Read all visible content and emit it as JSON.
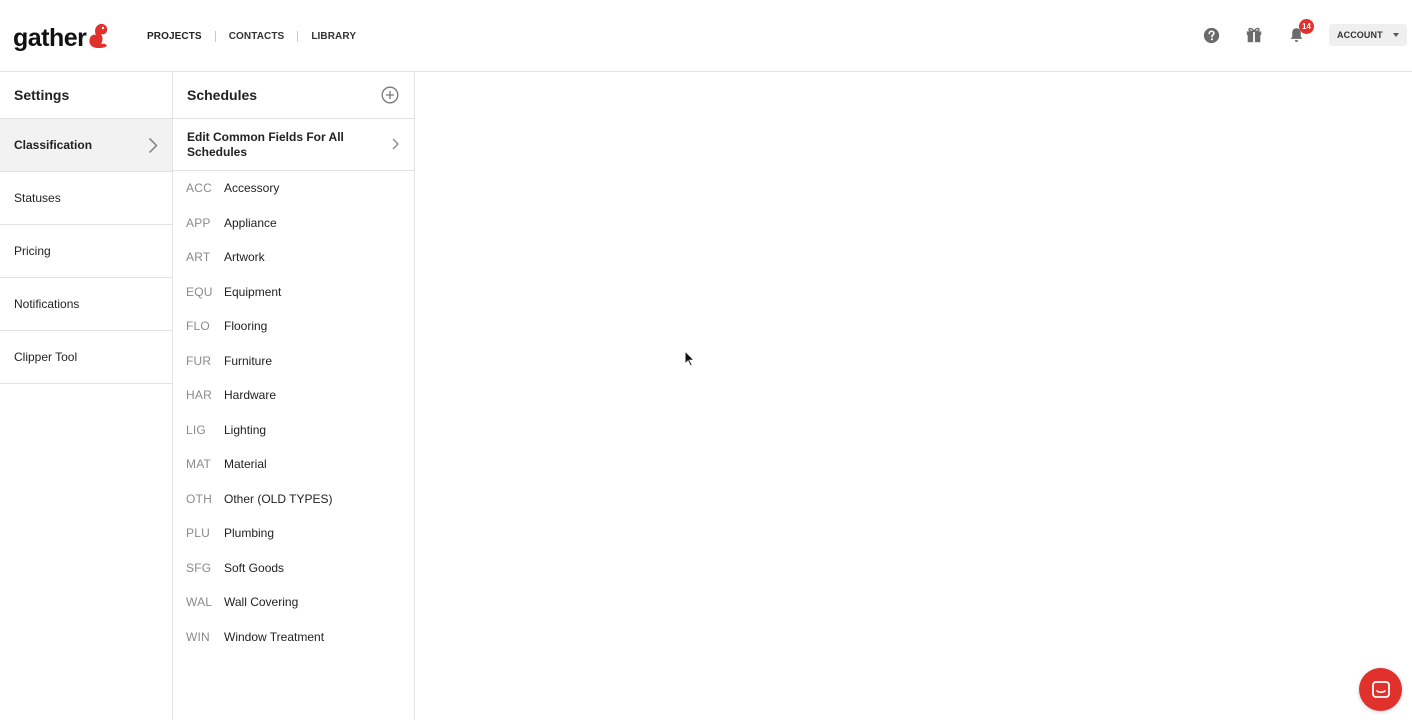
{
  "brand": {
    "logo_text": "gather",
    "accent_color": "#e0312c"
  },
  "nav": {
    "items": [
      {
        "label": "PROJECTS"
      },
      {
        "label": "CONTACTS"
      },
      {
        "label": "LIBRARY"
      }
    ]
  },
  "header": {
    "help_icon": "help-circle-icon",
    "gift_icon": "gift-icon",
    "bell_icon": "bell-icon",
    "notification_count": "14",
    "account_label": "ACCOUNT"
  },
  "settings": {
    "title": "Settings",
    "items": [
      {
        "label": "Classification",
        "active": true
      },
      {
        "label": "Statuses"
      },
      {
        "label": "Pricing"
      },
      {
        "label": "Notifications"
      },
      {
        "label": "Clipper Tool"
      }
    ]
  },
  "schedules": {
    "title": "Schedules",
    "edit_common_label": "Edit Common Fields For All Schedules",
    "items": [
      {
        "code": "ACC",
        "name": "Accessory"
      },
      {
        "code": "APP",
        "name": "Appliance"
      },
      {
        "code": "ART",
        "name": "Artwork"
      },
      {
        "code": "EQU",
        "name": "Equipment"
      },
      {
        "code": "FLO",
        "name": "Flooring"
      },
      {
        "code": "FUR",
        "name": "Furniture"
      },
      {
        "code": "HAR",
        "name": "Hardware"
      },
      {
        "code": "LIG",
        "name": "Lighting"
      },
      {
        "code": "MAT",
        "name": "Material"
      },
      {
        "code": "OTH",
        "name": "Other (OLD TYPES)"
      },
      {
        "code": "PLU",
        "name": "Plumbing"
      },
      {
        "code": "SFG",
        "name": "Soft Goods"
      },
      {
        "code": "WAL",
        "name": "Wall Covering"
      },
      {
        "code": "WIN",
        "name": "Window Treatment"
      }
    ]
  }
}
